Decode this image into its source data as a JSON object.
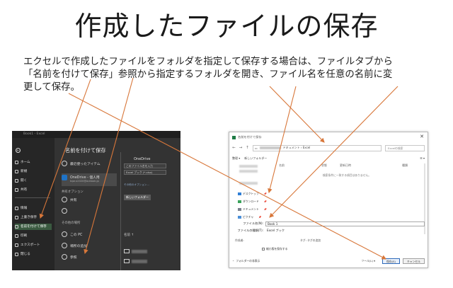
{
  "slide": {
    "title": "作成したファイルの保存",
    "body_lines": [
      "エクセルで作成したファイルをフォルダを指定して保存する場合は、ファイルタブから",
      "「名前を付けて保存」参照から指定するフォルダを開き、ファイル名を任意の名前に変",
      "更して保存。"
    ]
  },
  "excel_backstage": {
    "titlebar": "Book1 - Excel",
    "back_icon": "←",
    "nav": [
      "ホーム",
      "新規",
      "開く",
      "共有",
      "情報",
      "上書き保存",
      "名前を付けて保存",
      "印刷",
      "エクスポート",
      "閉じる"
    ],
    "active_nav_index": 6,
    "panel_title": "名前を付けて保存",
    "recent": "最近使ったアイテム",
    "onedrive": "OneDrive - 個人用",
    "onedrive_account": "tqor-s2020@outlook.jp",
    "shared_heading": "共有オプション",
    "share": "共有",
    "other_heading": "その他の場所",
    "this_pc": "この PC",
    "add_place": "場所の追加",
    "browse": "参照",
    "right_location": "OneDrive",
    "filename_box": "このファイル名を入力",
    "filetype_box": "Excel ブック (*.xlsx)",
    "more_options": "その他のオプション...",
    "new_folder": "新しいフォルダー",
    "name_column": "名前 ↑"
  },
  "save_dialog": {
    "title": "名前を付けて保存",
    "close": "✕",
    "address_tail": "ドキュメント › Excel",
    "search_placeholder": "Excelの検索",
    "toolbar_organize": "整理 ▾",
    "toolbar_newfolder": "新しいフォルダー",
    "quick_access": [
      "デスクトップ",
      "ダウンロード",
      "ドキュメント",
      "ピクチャ"
    ],
    "pin": "📌",
    "columns": [
      "名前",
      "状態",
      "更新日時",
      "種類"
    ],
    "empty_message": "検索条件に一致する項目はありません。",
    "filename_label": "ファイル名(N):",
    "filename_value": "Book 1",
    "filetype_label": "ファイルの種類(T):",
    "filetype_value": "Excel ブック",
    "authors_label": "作成者:",
    "tags_label": "タグ: タグの追加",
    "thumbnail_label": "縮小版を保存する",
    "hide_folders": "フォルダーの非表示",
    "tools": "ツール(L) ▾",
    "save_button": "保存(S)",
    "cancel_button": "キャンセル"
  },
  "colors": {
    "arrow": "#d8773a",
    "excel_bg": "#2b2b2b",
    "excel_active": "#3a5a40"
  }
}
